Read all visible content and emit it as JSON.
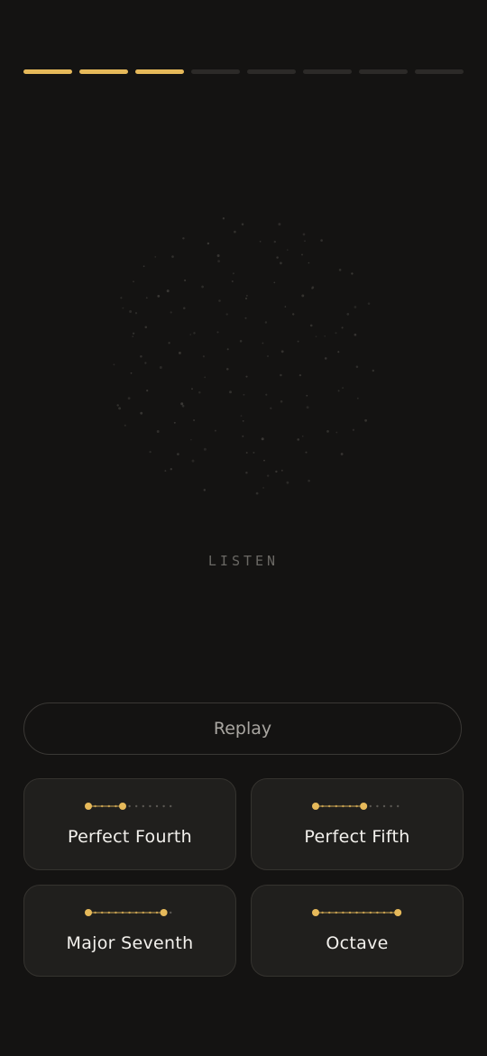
{
  "progress": {
    "total_steps": 8,
    "completed_steps": 3,
    "accent_color": "#e6b95a",
    "track_color": "#2c2a28"
  },
  "visualizer": {
    "icon": "dot-field-visualizer"
  },
  "status": {
    "label": "LISTEN"
  },
  "replay": {
    "label": "Replay"
  },
  "answers": [
    {
      "label": "Perfect Fourth",
      "interval_semitones": 5,
      "scale_steps": 12
    },
    {
      "label": "Perfect Fifth",
      "interval_semitones": 7,
      "scale_steps": 12
    },
    {
      "label": "Major Seventh",
      "interval_semitones": 11,
      "scale_steps": 12
    },
    {
      "label": "Octave",
      "interval_semitones": 12,
      "scale_steps": 12
    }
  ]
}
